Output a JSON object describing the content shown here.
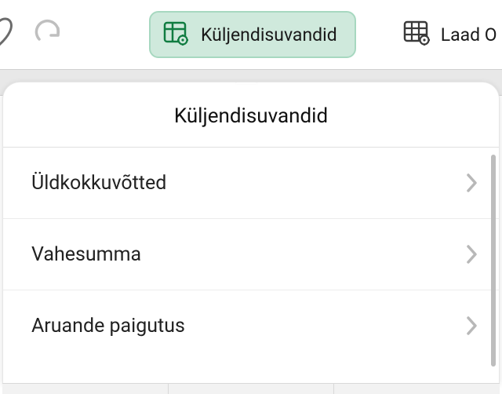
{
  "toolbar": {
    "layout_options_label": "Küljendisuvandid",
    "style_label": "Laad O"
  },
  "panel": {
    "title": "Küljendisuvandid",
    "items": [
      {
        "label": "Üldkokkuvõtted"
      },
      {
        "label": "Vahesumma"
      },
      {
        "label": "Aruande paigutus"
      }
    ]
  },
  "colors": {
    "accent_bg": "#cfe9dc",
    "accent_border": "#a7d8c0",
    "icon_green": "#107c41",
    "chevron": "#b8b8b8",
    "redo_disabled": "#bfbfbf"
  }
}
